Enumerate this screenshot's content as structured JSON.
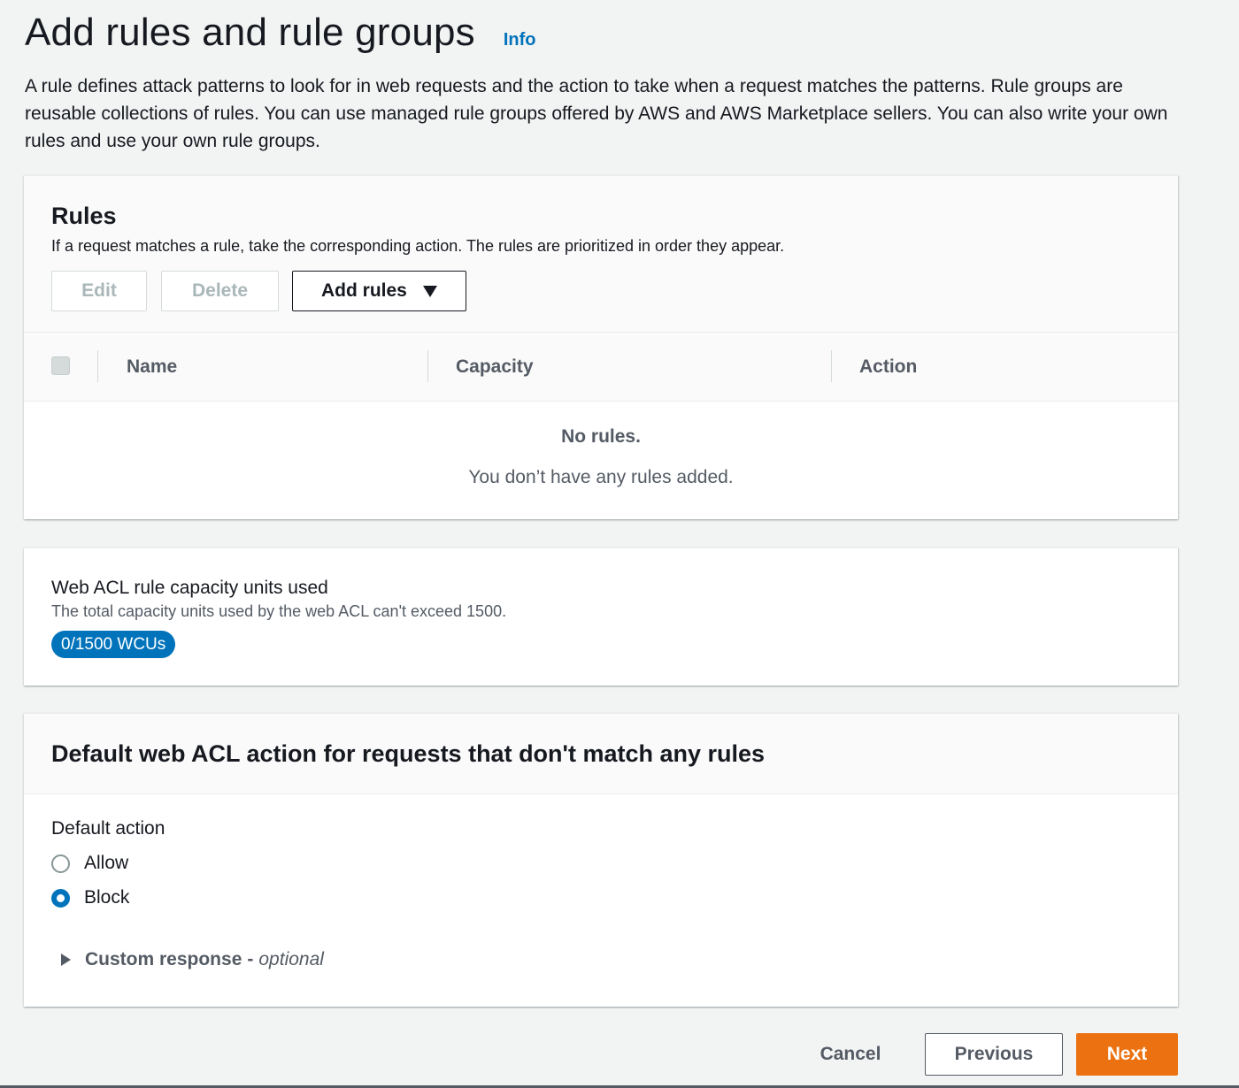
{
  "header": {
    "title": "Add rules and rule groups",
    "info_label": "Info",
    "description": "A rule defines attack patterns to look for in web requests and the action to take when a request matches the patterns. Rule groups are reusable collections of rules. You can use managed rule groups offered by AWS and AWS Marketplace sellers. You can also write your own rules and use your own rule groups."
  },
  "rules": {
    "title": "Rules",
    "description": "If a request matches a rule, take the corresponding action. The rules are prioritized in order they appear.",
    "buttons": {
      "edit": "Edit",
      "delete": "Delete",
      "add_rules": "Add rules"
    },
    "columns": [
      "Name",
      "Capacity",
      "Action"
    ],
    "empty_title": "No rules.",
    "empty_description": "You don’t have any rules added."
  },
  "capacity": {
    "title": "Web ACL rule capacity units used",
    "description": "The total capacity units used by the web ACL can't exceed 1500.",
    "badge": "0/1500 WCUs"
  },
  "default_action": {
    "title": "Default web ACL action for requests that don't match any rules",
    "label": "Default action",
    "options": [
      "Allow",
      "Block"
    ],
    "selected": "Block",
    "custom_response_label": "Custom response",
    "custom_response_separator": "-",
    "custom_response_optional": "optional"
  },
  "footer": {
    "cancel": "Cancel",
    "previous": "Previous",
    "next": "Next"
  },
  "colors": {
    "primary": "#ec7211",
    "link": "#0073bb",
    "badge": "#0073bb"
  }
}
